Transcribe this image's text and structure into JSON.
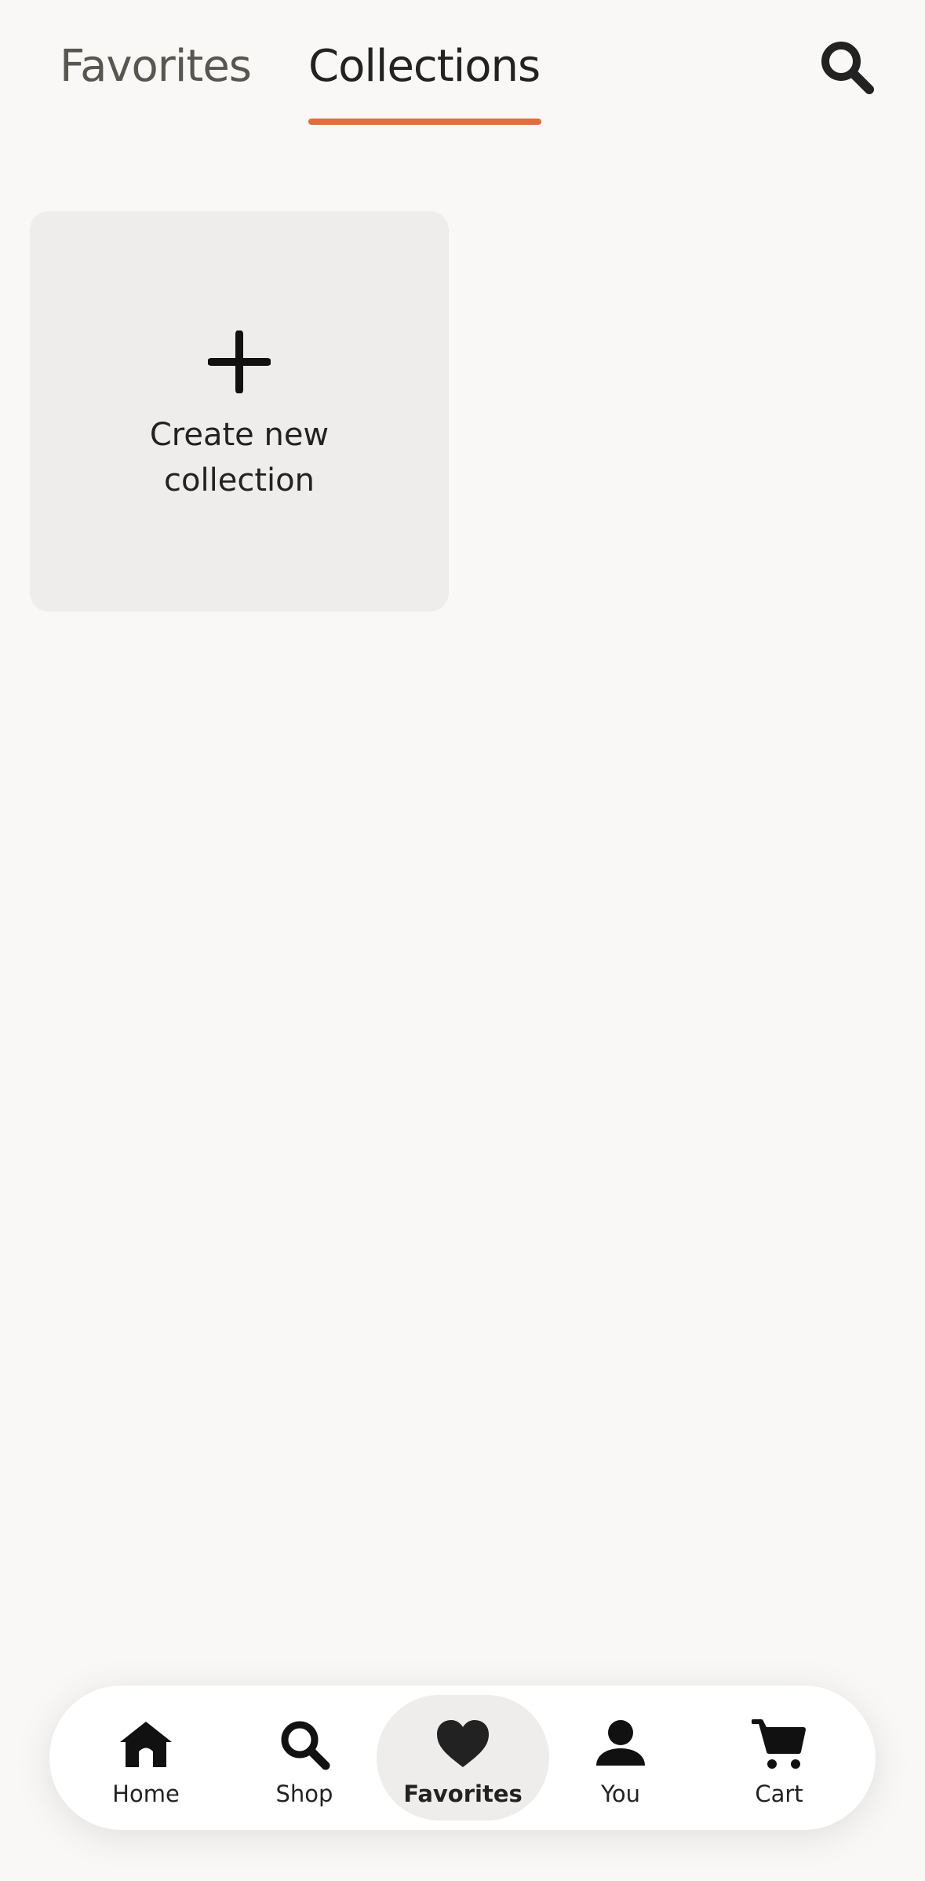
{
  "tabs": {
    "favorites_label": "Favorites",
    "collections_label": "Collections",
    "active": "Collections"
  },
  "header": {
    "search_icon": "search-icon"
  },
  "collections": {
    "create_label_line1": "Create new",
    "create_label_line2": "collection",
    "create_icon": "plus-icon"
  },
  "nav": {
    "items": [
      {
        "label": "Home",
        "icon": "home-icon"
      },
      {
        "label": "Shop",
        "icon": "search-icon"
      },
      {
        "label": "Favorites",
        "icon": "heart-icon",
        "active": true
      },
      {
        "label": "You",
        "icon": "person-icon"
      },
      {
        "label": "Cart",
        "icon": "cart-icon"
      }
    ]
  },
  "colors": {
    "background": "#f9f8f6",
    "accent": "#e16e3c",
    "card": "#eeedeb",
    "text": "#222222",
    "muted_text": "#595651"
  }
}
